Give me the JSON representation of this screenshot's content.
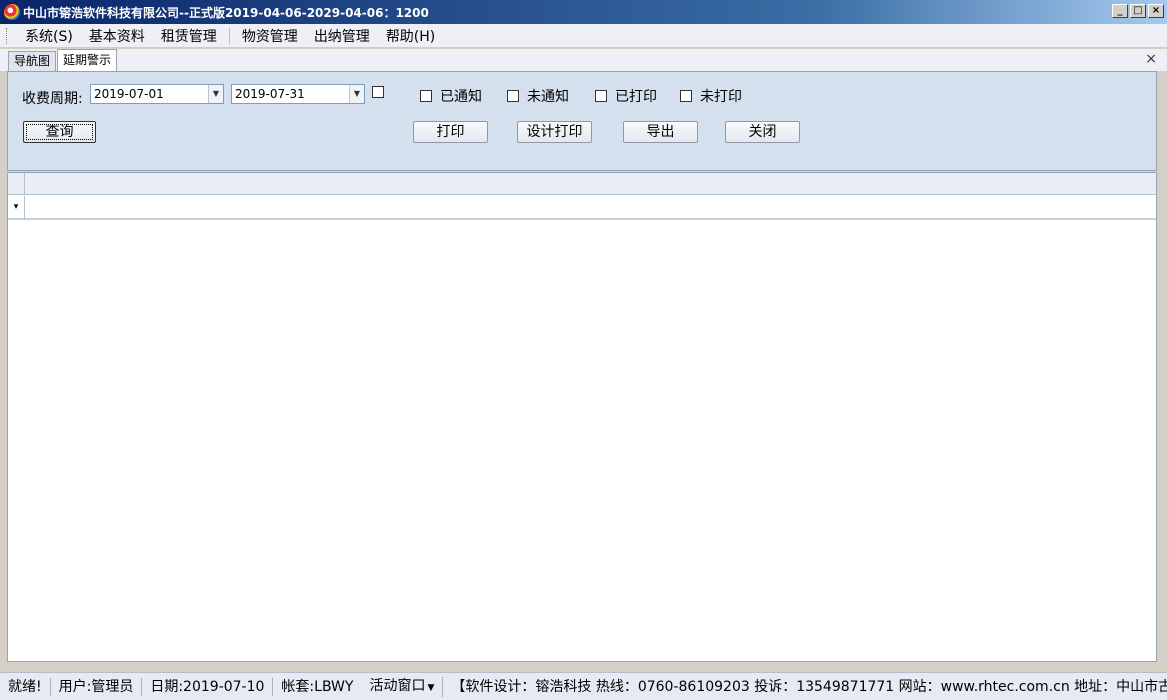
{
  "window": {
    "title": "中山市镕浩软件科技有限公司--正式版2019-04-06-2029-04-06：1200",
    "buttons": {
      "minimize": "_",
      "maximize": "□",
      "close": "×"
    }
  },
  "menu": [
    {
      "label": "系统(S)"
    },
    {
      "label": "基本资料"
    },
    {
      "label": "租赁管理"
    },
    {
      "label": "物资管理"
    },
    {
      "label": "出纳管理"
    },
    {
      "label": "帮助(H)"
    }
  ],
  "tabs": [
    {
      "label": "导航图",
      "active": false
    },
    {
      "label": "延期警示",
      "active": true
    }
  ],
  "tab_close": "×",
  "query": {
    "period_label": "收费周期:",
    "date_from": "2019-07-01",
    "date_to": "2019-07-31",
    "checkboxes": [
      {
        "label": "",
        "checked": false
      },
      {
        "label": "已通知",
        "checked": false
      },
      {
        "label": "未通知",
        "checked": false
      },
      {
        "label": "已打印",
        "checked": false
      },
      {
        "label": "未打印",
        "checked": false
      }
    ],
    "buttons": {
      "search": "查询",
      "print": "打印",
      "design_print": "设计打印",
      "export": "导出",
      "close": "关闭"
    }
  },
  "status": {
    "ready": "就绪!",
    "user": "用户:管理员",
    "date": "日期:2019-07-10",
    "account": "帐套:LBWY",
    "active_window": "活动窗口",
    "info": "【软件设计：镕浩科技 热线：0760-86109203 投诉：13549871771 网站：www.rhtec.com.cn 地址：中山市古镇六坊"
  },
  "icons": {
    "app": "app-logo-icon",
    "filter": "filter-row-icon",
    "dropdown": "chevron-down-icon"
  }
}
